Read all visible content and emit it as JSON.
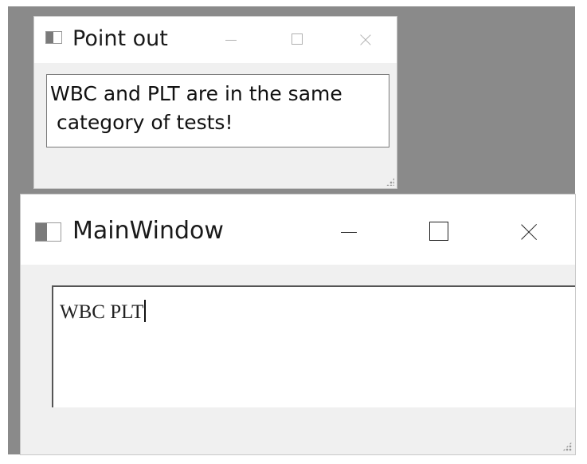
{
  "dialog": {
    "title": "Point out",
    "message": "WBC and PLT are in the same\n category of tests!",
    "icon": "app-window-icon"
  },
  "main_window": {
    "title": "MainWindow",
    "input_value": "WBC PLT",
    "icon": "app-window-icon"
  },
  "colors": {
    "desktop": "#8a8a8a",
    "window_body": "#f0f0f0",
    "titlebar": "#ffffff"
  }
}
